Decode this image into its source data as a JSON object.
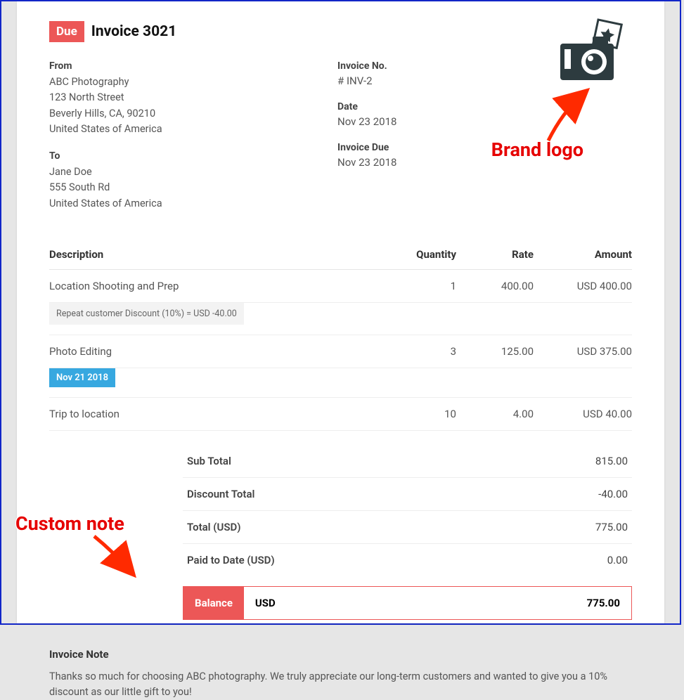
{
  "status_badge": "Due",
  "title": "Invoice 3021",
  "from": {
    "label": "From",
    "name": "ABC Photography",
    "line1": "123 North Street",
    "line2": "Beverly Hills, CA, 90210",
    "line3": "United States of America"
  },
  "to": {
    "label": "To",
    "name": "Jane Doe",
    "line1": "555 South Rd",
    "line2": "United States of America"
  },
  "inv_no": {
    "label": "Invoice No.",
    "value": "# INV-2"
  },
  "date": {
    "label": "Date",
    "value": "Nov 23 2018"
  },
  "due_date": {
    "label": "Invoice Due",
    "value": "Nov 23 2018"
  },
  "columns": {
    "desc": "Description",
    "qty": "Quantity",
    "rate": "Rate",
    "amt": "Amount"
  },
  "items": [
    {
      "desc": "Location Shooting and Prep",
      "qty": "1",
      "rate": "400.00",
      "amt": "USD 400.00",
      "discount": "Repeat customer Discount (10%) = USD -40.00"
    },
    {
      "desc": "Photo Editing",
      "qty": "3",
      "rate": "125.00",
      "amt": "USD 375.00",
      "tag": "Nov 21 2018"
    },
    {
      "desc": "Trip to location",
      "qty": "10",
      "rate": "4.00",
      "amt": "USD 40.00"
    }
  ],
  "summary": {
    "subtotal": {
      "label": "Sub Total",
      "value": "815.00"
    },
    "discount_total": {
      "label": "Discount Total",
      "value": "-40.00"
    },
    "total": {
      "label": "Total (USD)",
      "value": "775.00"
    },
    "paid": {
      "label": "Paid to Date (USD)",
      "value": "0.00"
    },
    "balance": {
      "label": "Balance",
      "currency": "USD",
      "value": "775.00"
    }
  },
  "note": {
    "label": "Invoice Note",
    "body": "Thanks so much for choosing ABC photography. We truly appreciate our long-term customers and wanted to give you a 10% discount as our little gift to you!"
  },
  "annotations": {
    "logo": "Brand logo",
    "note": "Custom note"
  }
}
